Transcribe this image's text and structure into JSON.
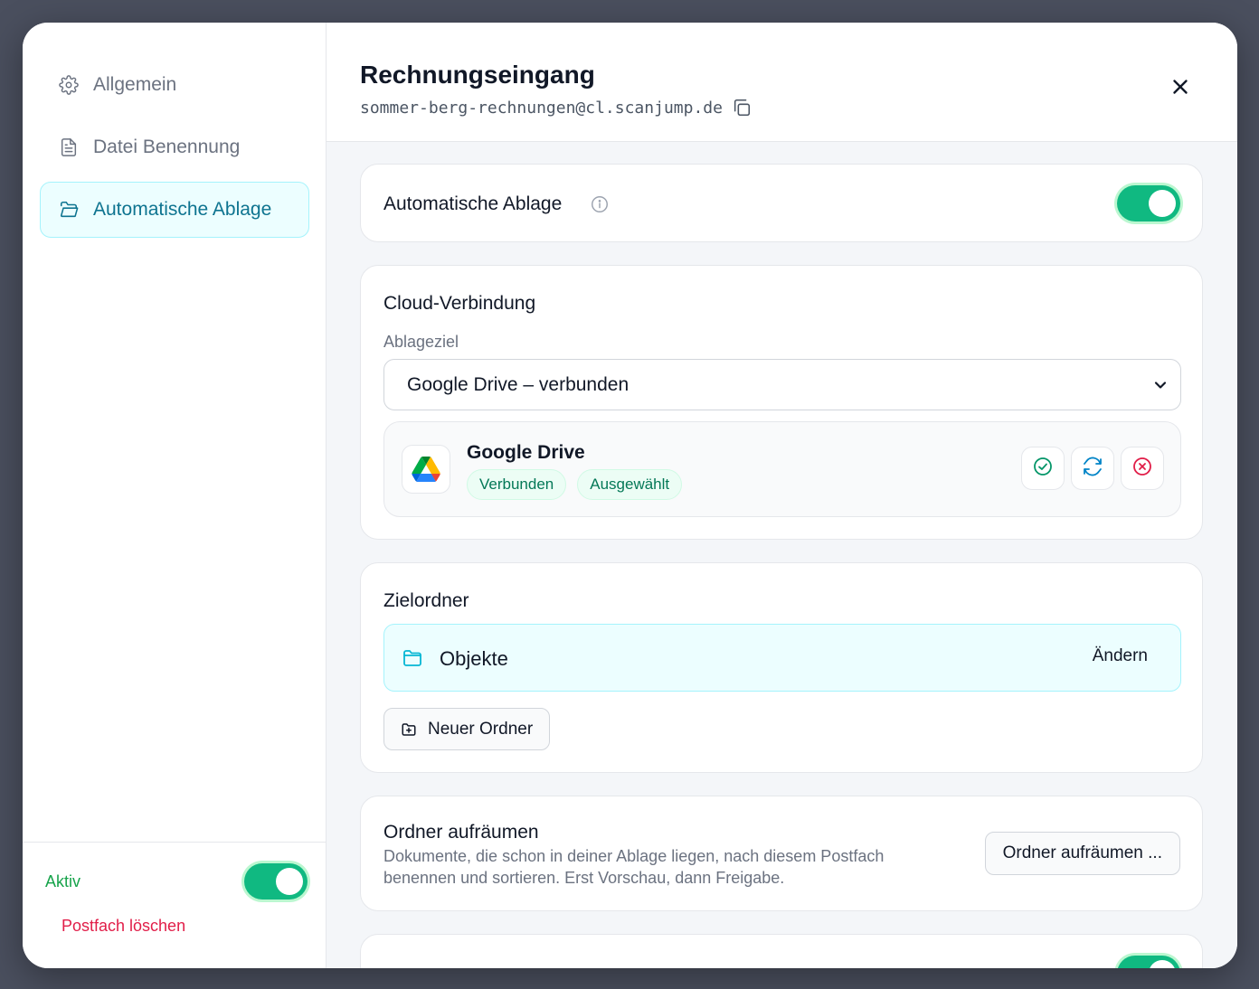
{
  "sidebar": {
    "items": [
      {
        "label": "Allgemein",
        "icon": "gear-icon",
        "active": false
      },
      {
        "label": "Datei Benennung",
        "icon": "document-icon",
        "active": false
      },
      {
        "label": "Automatische Ablage",
        "icon": "folder-open-icon",
        "active": true
      }
    ],
    "active_label": "Aktiv",
    "active_state": true,
    "delete_label": "Postfach löschen"
  },
  "header": {
    "title": "Rechnungseingang",
    "email": "sommer-berg-rechnungen@cl.scanjump.de"
  },
  "auto_filing": {
    "title": "Automatische Ablage",
    "enabled": true
  },
  "cloud": {
    "title": "Cloud-Verbindung",
    "target_label": "Ablageziel",
    "target_value": "Google Drive – verbunden",
    "provider": {
      "name": "Google Drive",
      "badges": [
        "Verbunden",
        "Ausgewählt"
      ]
    }
  },
  "target_folder": {
    "title": "Zielordner",
    "folder_name": "Objekte",
    "change_label": "Ändern",
    "new_folder_label": "Neuer Ordner"
  },
  "cleanup": {
    "title": "Ordner aufräumen",
    "description": "Dokumente, die schon in deiner Ablage liegen, nach diesem Postfach benennen und sortieren. Erst Vorschau, dann Freigabe.",
    "button_label": "Ordner aufräumen ..."
  },
  "colors": {
    "accent": "#10b981",
    "active_nav_bg": "#ecfeff",
    "active_nav_text": "#0e7490",
    "danger": "#e11d48"
  }
}
